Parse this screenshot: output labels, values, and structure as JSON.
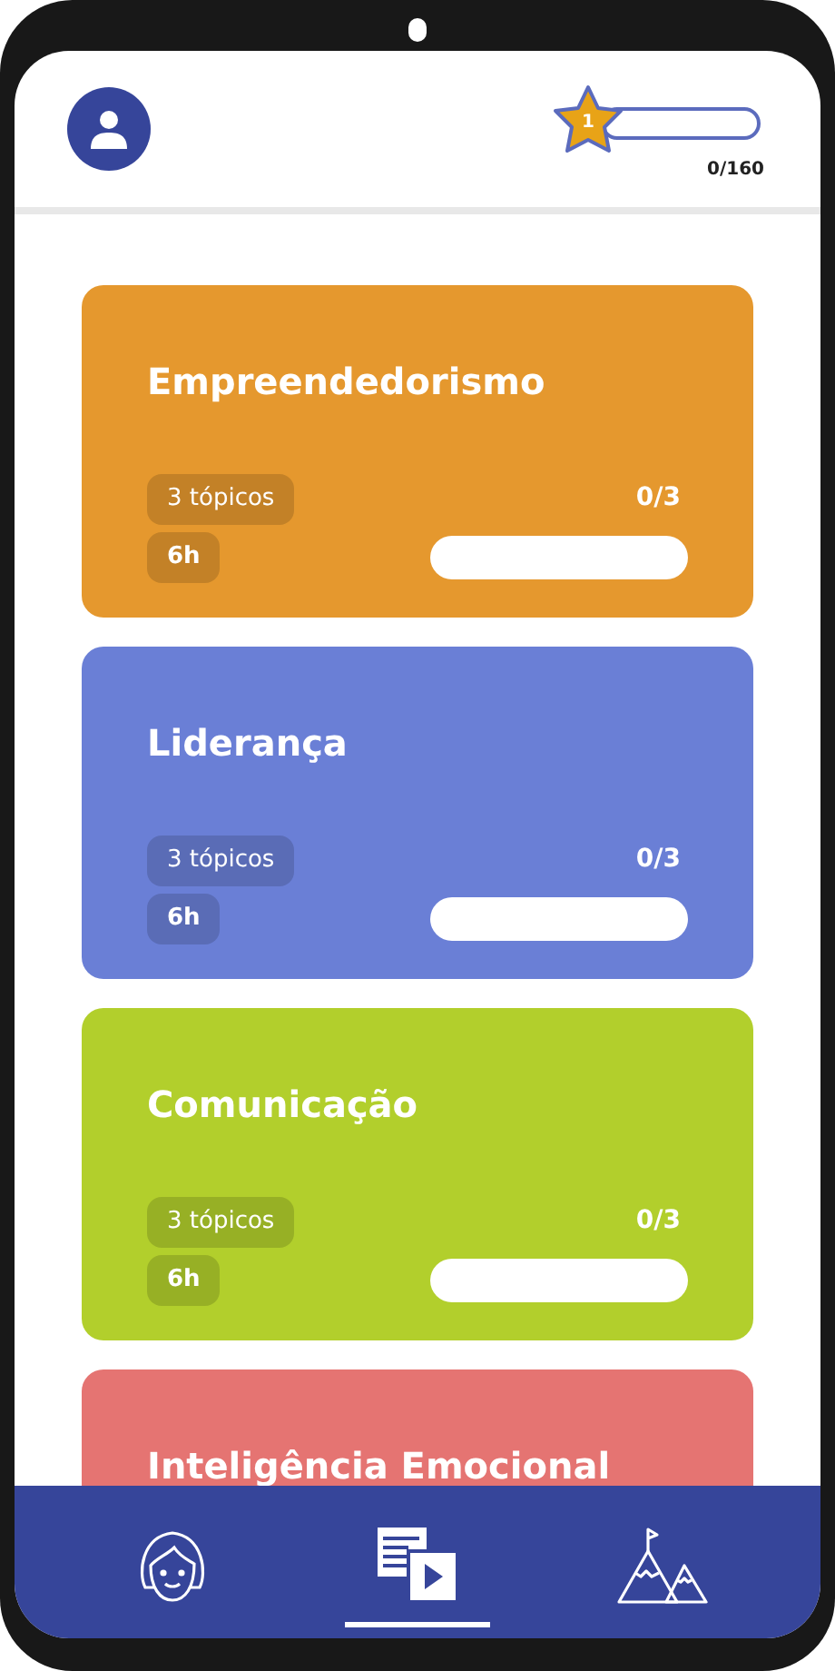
{
  "header": {
    "star": {
      "label": "1",
      "level": 0
    },
    "points": "0/160"
  },
  "courses": [
    {
      "title": "Empreendedorismo",
      "topics": "3 tópicos",
      "duration": "6h",
      "progress": "0/3",
      "level": 0,
      "color": "#e5982e"
    },
    {
      "title": "Liderança",
      "topics": "3 tópicos",
      "duration": "6h",
      "progress": "0/3",
      "level": 0,
      "color": "#6a7fd6"
    },
    {
      "title": "Comunicação",
      "topics": "3 tópicos",
      "duration": "6h",
      "progress": "0/3",
      "level": 0,
      "color": "#b2cf2c"
    },
    {
      "title": "Inteligência Emocional",
      "color": "#e57472"
    }
  ],
  "nav": [
    {
      "kind": "profile",
      "selected": false
    },
    {
      "kind": "courses",
      "selected": true
    },
    {
      "kind": "goals",
      "selected": false
    }
  ]
}
